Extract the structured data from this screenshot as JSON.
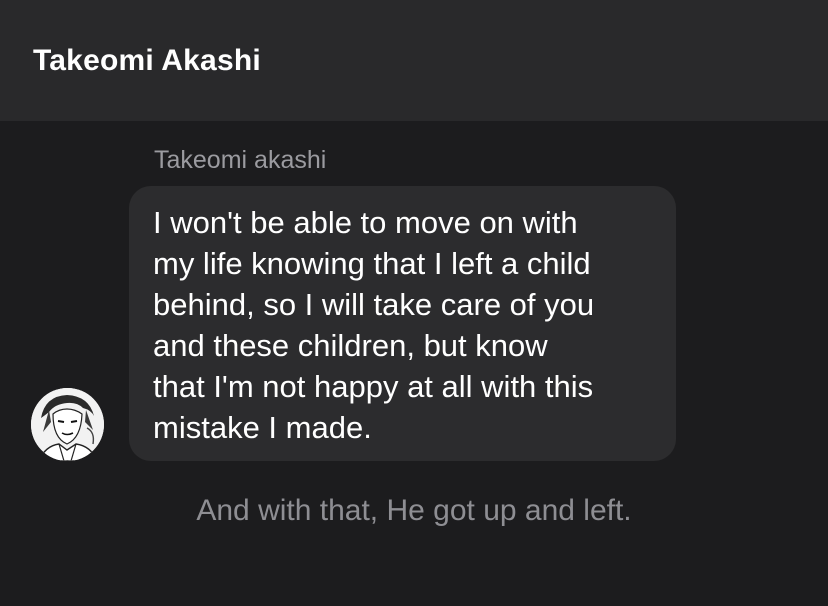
{
  "header": {
    "title": "Takeomi Akashi"
  },
  "message": {
    "sender": "Takeomi akashi",
    "text": "I won't be able to move on with\nmy life knowing that I left a child\nbehind, so I will take care of you\nand these children, but know\nthat I'm not happy at all with this\nmistake I made.",
    "avatar_icon": "character-avatar"
  },
  "narration": {
    "text": "And with that, He got up and left."
  },
  "colors": {
    "header_bg": "#29292b",
    "chat_bg": "#1c1c1e",
    "bubble_bg": "#2c2c2e",
    "secondary_text": "#9b9ba0"
  }
}
